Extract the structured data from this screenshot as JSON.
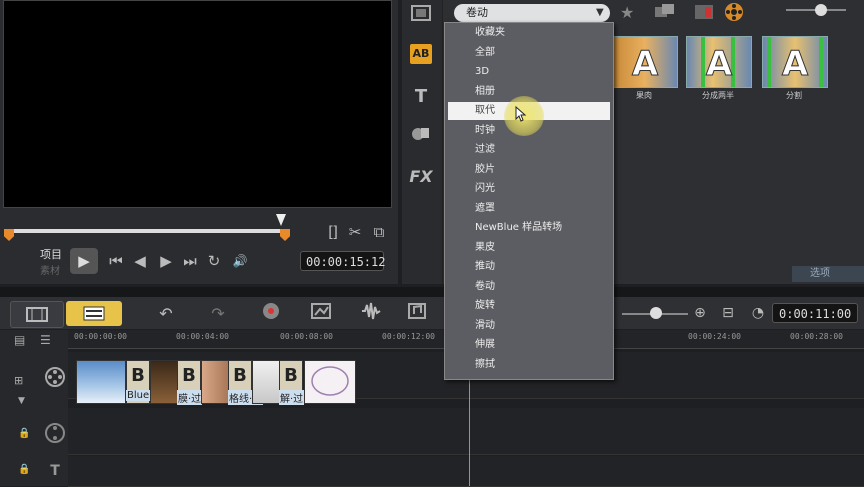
{
  "preview": {
    "label_project": "项目",
    "label_clip": "素材",
    "timecode": "00:00:15:12",
    "controls": {
      "play": "▶",
      "start": "⏮",
      "prev_frame": "◀",
      "next_frame": "▶",
      "end": "⏭",
      "repeat": "↻",
      "volume": "🔊"
    },
    "marker_buttons": [
      "[",
      "]",
      "✂",
      "⧉"
    ]
  },
  "library": {
    "sidebar_icons": [
      "media-icon",
      "transition-icon",
      "title-icon",
      "graphics-icon",
      "fx-icon"
    ],
    "transition_icon_text": "AB",
    "title_icon_text": "T",
    "fx_icon_text": "FX",
    "category_selected": "卷动",
    "thumbnails": [
      {
        "label": "果肉",
        "accent": "#e8a23a"
      },
      {
        "label": "分成两半",
        "accent": "#3ac040"
      },
      {
        "label": "分割",
        "accent": "#3ac040"
      }
    ],
    "options_label": "选项"
  },
  "dropdown": {
    "items": [
      "收藏夹",
      "全部",
      "3D",
      "相册",
      "取代",
      "时钟",
      "过滤",
      "胶片",
      "闪光",
      "遮罩",
      "NewBlue 样品转场",
      "果皮",
      "推动",
      "卷动",
      "旋转",
      "滑动",
      "伸展",
      "擦拭"
    ],
    "highlighted_index": 4
  },
  "toolbar": {
    "duration": "0:00:11:00",
    "undo": "↶",
    "redo": "↷"
  },
  "timeline": {
    "ticks": [
      "00:00:00:00",
      "00:00:04:00",
      "00:00:08:00",
      "00:00:12:00",
      "00:00:24:00",
      "00:00:28:00"
    ],
    "transition_letters": [
      "B",
      "B",
      "B",
      "B"
    ],
    "transition_labels": [
      "Blue",
      "膜·过",
      "格线·滑",
      "解·过"
    ]
  },
  "colors": {
    "accent_orange": "#e8892b",
    "timeline_button": "#e8c34a",
    "playhead": "#4aa8e8"
  }
}
